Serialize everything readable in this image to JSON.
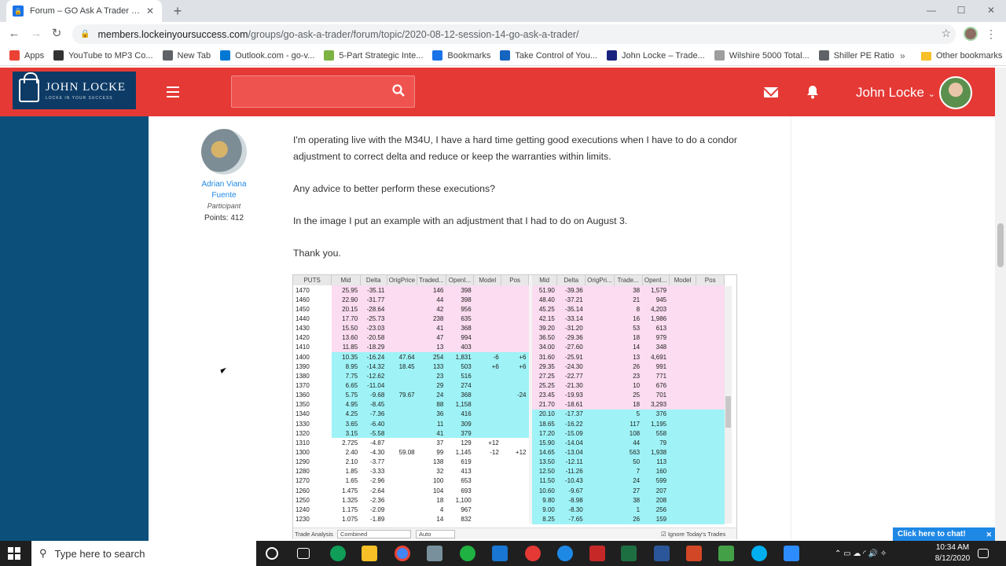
{
  "browser": {
    "tab_title": "Forum – GO Ask A Trader Session",
    "url_domain": "members.lockeinyoursuccess.com",
    "url_path": "/groups/go-ask-a-trader/forum/topic/2020-08-12-session-14-go-ask-a-trader/",
    "bookmarks": [
      {
        "label": "Apps",
        "icon": "apps-icon",
        "color": "#ea4335"
      },
      {
        "label": "YouTube to MP3 Co...",
        "icon": "music-note-icon",
        "color": "#333333"
      },
      {
        "label": "New Tab",
        "icon": "globe-icon",
        "color": "#5f6368"
      },
      {
        "label": "Outlook.com - go-v...",
        "icon": "outlook-icon",
        "color": "#0078d4"
      },
      {
        "label": "5-Part Strategic Inte...",
        "icon": "circle-icon",
        "color": "#7cb342"
      },
      {
        "label": "Bookmarks",
        "icon": "star-icon",
        "color": "#1a73e8"
      },
      {
        "label": "Take Control of You...",
        "icon": "c-icon",
        "color": "#1565c0"
      },
      {
        "label": "John Locke – Trade...",
        "icon": "lock-icon",
        "color": "#1a237e"
      },
      {
        "label": "Wilshire 5000 Total...",
        "icon": "chart-icon",
        "color": "#9e9e9e"
      },
      {
        "label": "Shiller PE Ratio",
        "icon": "loading-icon",
        "color": "#5f6368"
      }
    ],
    "bookmarks_more": "»",
    "other_bookmarks": "Other bookmarks"
  },
  "site": {
    "logo_text": "JOHN LOCKE",
    "logo_sub": "LOCKE IN YOUR SUCCESS",
    "user_name": "John Locke",
    "search_placeholder": ""
  },
  "post": {
    "author_name_line1": "Adrian Viana",
    "author_name_line2": "Fuente",
    "author_role": "Participant",
    "author_points": "Points: 412",
    "paragraphs": [
      "I'm operating live with the M34U, I have a hard time getting good executions when I have to do a condor adjustment to correct delta and reduce or keep the warranties within limits.",
      "Any advice to better perform these executions?",
      "In the image I put an example with an adjustment that I had to do on August 3.",
      "Thank you."
    ]
  },
  "chain": {
    "left_headers": [
      "PUTS",
      "Mid",
      "Delta",
      "OrigPrice",
      "Traded...",
      "OpenI...",
      "Model",
      "Pos"
    ],
    "right_headers": [
      "Mid",
      "Delta",
      "OrigPri...",
      "Trade...",
      "OpenI...",
      "Model",
      "Pos"
    ],
    "rows": [
      {
        "strike": "1470",
        "mid": "25.95",
        "delta": "-35.11",
        "orig": "",
        "traded": "146",
        "oi": "398",
        "model": "",
        "pos": "",
        "r_mid": "51.90",
        "r_delta": "-39.36",
        "r_orig": "",
        "r_traded": "38",
        "r_oi": "1,579",
        "r_model": "",
        "r_pos": "",
        "lc": "pink",
        "rc": "pink"
      },
      {
        "strike": "1460",
        "mid": "22.90",
        "delta": "-31.77",
        "orig": "",
        "traded": "44",
        "oi": "398",
        "model": "",
        "pos": "",
        "r_mid": "48.40",
        "r_delta": "-37.21",
        "r_orig": "",
        "r_traded": "21",
        "r_oi": "945",
        "r_model": "",
        "r_pos": "",
        "lc": "pink",
        "rc": "pink"
      },
      {
        "strike": "1450",
        "mid": "20.15",
        "delta": "-28.64",
        "orig": "",
        "traded": "42",
        "oi": "956",
        "model": "",
        "pos": "",
        "r_mid": "45.25",
        "r_delta": "-35.14",
        "r_orig": "",
        "r_traded": "8",
        "r_oi": "4,203",
        "r_model": "",
        "r_pos": "",
        "lc": "pink",
        "rc": "pink"
      },
      {
        "strike": "1440",
        "mid": "17.70",
        "delta": "-25.73",
        "orig": "",
        "traded": "238",
        "oi": "635",
        "model": "",
        "pos": "",
        "r_mid": "42.15",
        "r_delta": "-33.14",
        "r_orig": "",
        "r_traded": "16",
        "r_oi": "1,986",
        "r_model": "",
        "r_pos": "",
        "lc": "pink",
        "rc": "pink"
      },
      {
        "strike": "1430",
        "mid": "15.50",
        "delta": "-23.03",
        "orig": "",
        "traded": "41",
        "oi": "368",
        "model": "",
        "pos": "",
        "r_mid": "39.20",
        "r_delta": "-31.20",
        "r_orig": "",
        "r_traded": "53",
        "r_oi": "613",
        "r_model": "",
        "r_pos": "",
        "lc": "pink",
        "rc": "pink"
      },
      {
        "strike": "1420",
        "mid": "13.60",
        "delta": "-20.58",
        "orig": "",
        "traded": "47",
        "oi": "994",
        "model": "",
        "pos": "",
        "r_mid": "36.50",
        "r_delta": "-29.36",
        "r_orig": "",
        "r_traded": "18",
        "r_oi": "979",
        "r_model": "",
        "r_pos": "",
        "lc": "pink",
        "rc": "pink"
      },
      {
        "strike": "1410",
        "mid": "11.85",
        "delta": "-18.29",
        "orig": "",
        "traded": "13",
        "oi": "403",
        "model": "",
        "pos": "",
        "r_mid": "34.00",
        "r_delta": "-27.60",
        "r_orig": "",
        "r_traded": "14",
        "r_oi": "348",
        "r_model": "",
        "r_pos": "",
        "lc": "pink",
        "rc": "pink"
      },
      {
        "strike": "1400",
        "mid": "10.35",
        "delta": "-16.24",
        "orig": "47.64",
        "traded": "254",
        "oi": "1,831",
        "model": "-6",
        "pos": "+6",
        "r_mid": "31.60",
        "r_delta": "-25.91",
        "r_orig": "",
        "r_traded": "13",
        "r_oi": "4,691",
        "r_model": "",
        "r_pos": "",
        "lc": "cyan",
        "rc": "pink"
      },
      {
        "strike": "1390",
        "mid": "8.95",
        "delta": "-14.32",
        "orig": "18.45",
        "traded": "133",
        "oi": "503",
        "model": "+6",
        "pos": "+6",
        "r_mid": "29.35",
        "r_delta": "-24.30",
        "r_orig": "",
        "r_traded": "26",
        "r_oi": "991",
        "r_model": "",
        "r_pos": "",
        "lc": "cyan",
        "rc": "pink"
      },
      {
        "strike": "1380",
        "mid": "7.75",
        "delta": "-12.62",
        "orig": "",
        "traded": "23",
        "oi": "516",
        "model": "",
        "pos": "",
        "r_mid": "27.25",
        "r_delta": "-22.77",
        "r_orig": "",
        "r_traded": "23",
        "r_oi": "771",
        "r_model": "",
        "r_pos": "",
        "lc": "cyan",
        "rc": "pink"
      },
      {
        "strike": "1370",
        "mid": "6.65",
        "delta": "-11.04",
        "orig": "",
        "traded": "29",
        "oi": "274",
        "model": "",
        "pos": "",
        "r_mid": "25.25",
        "r_delta": "-21.30",
        "r_orig": "",
        "r_traded": "10",
        "r_oi": "676",
        "r_model": "",
        "r_pos": "",
        "lc": "cyan",
        "rc": "pink"
      },
      {
        "strike": "1360",
        "mid": "5.75",
        "delta": "-9.68",
        "orig": "79.67",
        "traded": "24",
        "oi": "368",
        "model": "",
        "pos": "-24",
        "r_mid": "23.45",
        "r_delta": "-19.93",
        "r_orig": "",
        "r_traded": "25",
        "r_oi": "701",
        "r_model": "",
        "r_pos": "",
        "lc": "cyan",
        "rc": "pink"
      },
      {
        "strike": "1350",
        "mid": "4.95",
        "delta": "-8.45",
        "orig": "",
        "traded": "88",
        "oi": "1,158",
        "model": "",
        "pos": "",
        "r_mid": "21.70",
        "r_delta": "-18.61",
        "r_orig": "",
        "r_traded": "18",
        "r_oi": "3,293",
        "r_model": "",
        "r_pos": "",
        "lc": "cyan",
        "rc": "pink"
      },
      {
        "strike": "1340",
        "mid": "4.25",
        "delta": "-7.36",
        "orig": "",
        "traded": "36",
        "oi": "416",
        "model": "",
        "pos": "",
        "r_mid": "20.10",
        "r_delta": "-17.37",
        "r_orig": "",
        "r_traded": "5",
        "r_oi": "376",
        "r_model": "",
        "r_pos": "",
        "lc": "cyan",
        "rc": "cyan"
      },
      {
        "strike": "1330",
        "mid": "3.65",
        "delta": "-6.40",
        "orig": "",
        "traded": "11",
        "oi": "309",
        "model": "",
        "pos": "",
        "r_mid": "18.65",
        "r_delta": "-16.22",
        "r_orig": "",
        "r_traded": "117",
        "r_oi": "1,195",
        "r_model": "",
        "r_pos": "",
        "lc": "cyan",
        "rc": "cyan"
      },
      {
        "strike": "1320",
        "mid": "3.15",
        "delta": "-5.58",
        "orig": "",
        "traded": "41",
        "oi": "379",
        "model": "",
        "pos": "",
        "r_mid": "17.20",
        "r_delta": "-15.09",
        "r_orig": "",
        "r_traded": "108",
        "r_oi": "558",
        "r_model": "",
        "r_pos": "",
        "lc": "cyan",
        "rc": "cyan"
      },
      {
        "strike": "1310",
        "mid": "2.725",
        "delta": "-4.87",
        "orig": "",
        "traded": "37",
        "oi": "129",
        "model": "+12",
        "pos": "",
        "r_mid": "15.90",
        "r_delta": "-14.04",
        "r_orig": "",
        "r_traded": "44",
        "r_oi": "79",
        "r_model": "",
        "r_pos": "",
        "lc": "white",
        "rc": "cyan"
      },
      {
        "strike": "1300",
        "mid": "2.40",
        "delta": "-4.30",
        "orig": "59.08",
        "traded": "99",
        "oi": "1,145",
        "model": "-12",
        "pos": "+12",
        "r_mid": "14.65",
        "r_delta": "-13.04",
        "r_orig": "",
        "r_traded": "563",
        "r_oi": "1,938",
        "r_model": "",
        "r_pos": "",
        "lc": "white",
        "rc": "cyan"
      },
      {
        "strike": "1290",
        "mid": "2.10",
        "delta": "-3.77",
        "orig": "",
        "traded": "138",
        "oi": "619",
        "model": "",
        "pos": "",
        "r_mid": "13.50",
        "r_delta": "-12.11",
        "r_orig": "",
        "r_traded": "50",
        "r_oi": "113",
        "r_model": "",
        "r_pos": "",
        "lc": "white",
        "rc": "cyan"
      },
      {
        "strike": "1280",
        "mid": "1.85",
        "delta": "-3.33",
        "orig": "",
        "traded": "32",
        "oi": "413",
        "model": "",
        "pos": "",
        "r_mid": "12.50",
        "r_delta": "-11.26",
        "r_orig": "",
        "r_traded": "7",
        "r_oi": "160",
        "r_model": "",
        "r_pos": "",
        "lc": "white",
        "rc": "cyan"
      },
      {
        "strike": "1270",
        "mid": "1.65",
        "delta": "-2.96",
        "orig": "",
        "traded": "100",
        "oi": "653",
        "model": "",
        "pos": "",
        "r_mid": "11.50",
        "r_delta": "-10.43",
        "r_orig": "",
        "r_traded": "24",
        "r_oi": "599",
        "r_model": "",
        "r_pos": "",
        "lc": "white",
        "rc": "cyan"
      },
      {
        "strike": "1260",
        "mid": "1.475",
        "delta": "-2.64",
        "orig": "",
        "traded": "104",
        "oi": "693",
        "model": "",
        "pos": "",
        "r_mid": "10.60",
        "r_delta": "-9.67",
        "r_orig": "",
        "r_traded": "27",
        "r_oi": "207",
        "r_model": "",
        "r_pos": "",
        "lc": "white",
        "rc": "cyan"
      },
      {
        "strike": "1250",
        "mid": "1.325",
        "delta": "-2.36",
        "orig": "",
        "traded": "18",
        "oi": "1,100",
        "model": "",
        "pos": "",
        "r_mid": "9.80",
        "r_delta": "-8.98",
        "r_orig": "",
        "r_traded": "38",
        "r_oi": "208",
        "r_model": "",
        "r_pos": "",
        "lc": "white",
        "rc": "cyan"
      },
      {
        "strike": "1240",
        "mid": "1.175",
        "delta": "-2.09",
        "orig": "",
        "traded": "4",
        "oi": "967",
        "model": "",
        "pos": "",
        "r_mid": "9.00",
        "r_delta": "-8.30",
        "r_orig": "",
        "r_traded": "1",
        "r_oi": "256",
        "r_model": "",
        "r_pos": "",
        "lc": "white",
        "rc": "cyan"
      },
      {
        "strike": "1230",
        "mid": "1.075",
        "delta": "-1.89",
        "orig": "",
        "traded": "14",
        "oi": "832",
        "model": "",
        "pos": "",
        "r_mid": "8.25",
        "r_delta": "-7.65",
        "r_orig": "",
        "r_traded": "26",
        "r_oi": "159",
        "r_model": "",
        "r_pos": "",
        "lc": "white",
        "rc": "cyan"
      }
    ],
    "footer_label": "Trade Analysis",
    "footer_select1": "Combined",
    "footer_select2": "Auto",
    "footer_checkbox": "Ignore Today's Trades"
  },
  "chat_button": "Click here to chat!",
  "taskbar": {
    "search_placeholder": "Type here to search",
    "time": "10:34 AM",
    "date": "8/12/2020"
  },
  "colors": {
    "header_red": "#e53935",
    "sidebar_blue": "#0b4f7a",
    "link_blue": "#1e88e5",
    "pink_row": "#fbdcf0",
    "cyan_row": "#9ff3f6"
  }
}
